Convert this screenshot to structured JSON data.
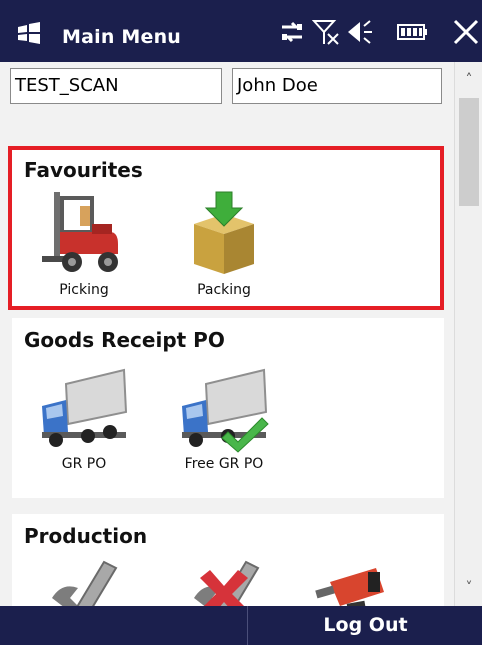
{
  "title_bar": {
    "title": "Main Menu",
    "icons": [
      "windows-flag-icon",
      "connectivity-icon",
      "no-signal-icon",
      "volume-icon",
      "battery-icon",
      "close-icon"
    ]
  },
  "header_fields": {
    "scan_value": "TEST_SCAN",
    "user_value": "John Doe"
  },
  "sections": [
    {
      "title": "Favourites",
      "tiles": [
        {
          "label": "Picking",
          "icon": "forklift-icon"
        },
        {
          "label": "Packing",
          "icon": "box-download-icon"
        }
      ]
    },
    {
      "title": "Goods Receipt PO",
      "tiles": [
        {
          "label": "GR PO",
          "icon": "truck-icon"
        },
        {
          "label": "Free GR PO",
          "icon": "truck-check-icon"
        }
      ]
    },
    {
      "title": "Production",
      "tiles": [
        {
          "label": "",
          "icon": "wrench-icon"
        },
        {
          "label": "",
          "icon": "wrench-x-icon"
        },
        {
          "label": "",
          "icon": "drill-icon"
        }
      ]
    }
  ],
  "bottom_bar": {
    "right_label": "Log Out"
  },
  "colors": {
    "bar_background": "#1b1f4d",
    "highlight_border": "#e51e25"
  }
}
